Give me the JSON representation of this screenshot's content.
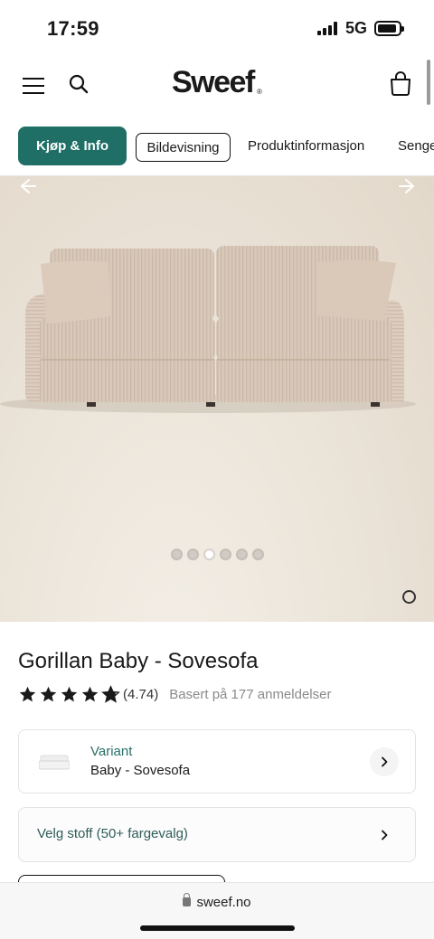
{
  "status_bar": {
    "time": "17:59",
    "network": "5G"
  },
  "header": {
    "logo": "Sweef",
    "logo_mark": "®",
    "icons": [
      "menu-icon",
      "search-icon",
      "shopping-bag-icon"
    ]
  },
  "tabs": [
    {
      "label": "Kjøp & Info",
      "state": "active"
    },
    {
      "label": "Bildevisning",
      "state": "outlined"
    },
    {
      "label": "Produktinformasjon",
      "state": "plain"
    },
    {
      "label": "Senge",
      "state": "plain"
    }
  ],
  "gallery": {
    "image_count": 6,
    "active_index": 2,
    "icons": [
      "arrow-left-icon",
      "arrow-right-icon"
    ]
  },
  "product": {
    "title": "Gorillan Baby - Sovesofa",
    "rating": 4.74,
    "rating_text": "(4.74)",
    "reviews_text": "Basert på 177 anmeldelser",
    "star_color": "#1a1a1a"
  },
  "variant": {
    "label": "Variant",
    "value": "Baby - Sovesofa"
  },
  "fabric": {
    "label": "Velg stoff (50+ fargevalg)"
  },
  "browser": {
    "url": "sweef.no"
  },
  "colors": {
    "accent": "#1f6f66",
    "variant_label": "#2a6f68"
  }
}
